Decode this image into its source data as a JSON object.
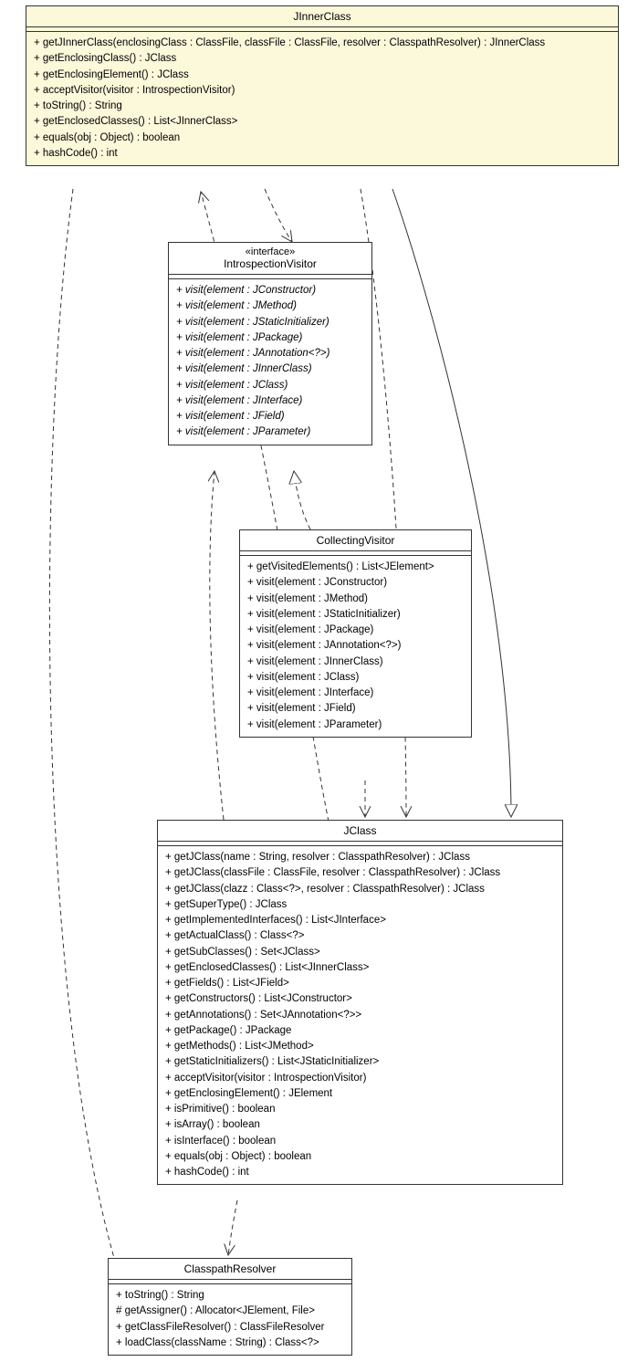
{
  "classes": {
    "jinnerclass": {
      "title": "JInnerClass",
      "ops": [
        "+ getJInnerClass(enclosingClass : ClassFile, classFile : ClassFile, resolver : ClasspathResolver) : JInnerClass",
        "+ getEnclosingClass() : JClass",
        "+ getEnclosingElement() : JClass",
        "+ acceptVisitor(visitor : IntrospectionVisitor)",
        "+ toString() : String",
        "+ getEnclosedClasses() : List<JInnerClass>",
        "+ equals(obj : Object) : boolean",
        "+ hashCode() : int"
      ]
    },
    "introspectionvisitor": {
      "stereotype": "«interface»",
      "title": "IntrospectionVisitor",
      "ops": [
        "+ visit(element : JConstructor)",
        "+ visit(element : JMethod)",
        "+ visit(element : JStaticInitializer)",
        "+ visit(element : JPackage)",
        "+ visit(element : JAnnotation<?>)",
        "+ visit(element : JInnerClass)",
        "+ visit(element : JClass)",
        "+ visit(element : JInterface)",
        "+ visit(element : JField)",
        "+ visit(element : JParameter)"
      ]
    },
    "collectingvisitor": {
      "title": "CollectingVisitor",
      "ops": [
        "+ getVisitedElements() : List<JElement>",
        "+ visit(element : JConstructor)",
        "+ visit(element : JMethod)",
        "+ visit(element : JStaticInitializer)",
        "+ visit(element : JPackage)",
        "+ visit(element : JAnnotation<?>)",
        "+ visit(element : JInnerClass)",
        "+ visit(element : JClass)",
        "+ visit(element : JInterface)",
        "+ visit(element : JField)",
        "+ visit(element : JParameter)"
      ]
    },
    "jclass": {
      "title": "JClass",
      "ops": [
        "+ getJClass(name : String, resolver : ClasspathResolver) : JClass",
        "+ getJClass(classFile : ClassFile, resolver : ClasspathResolver) : JClass",
        "+ getJClass(clazz : Class<?>, resolver : ClasspathResolver) : JClass",
        "+ getSuperType() : JClass",
        "+ getImplementedInterfaces() : List<JInterface>",
        "+ getActualClass() : Class<?>",
        "+ getSubClasses() : Set<JClass>",
        "+ getEnclosedClasses() : List<JInnerClass>",
        "+ getFields() : List<JField>",
        "+ getConstructors() : List<JConstructor>",
        "+ getAnnotations() : Set<JAnnotation<?>>",
        "+ getPackage() : JPackage",
        "+ getMethods() : List<JMethod>",
        "+ getStaticInitializers() : List<JStaticInitializer>",
        "+ acceptVisitor(visitor : IntrospectionVisitor)",
        "+ getEnclosingElement() : JElement",
        "+ isPrimitive() : boolean",
        "+ isArray() : boolean",
        "+ isInterface() : boolean",
        "+ equals(obj : Object) : boolean",
        "+ hashCode() : int"
      ]
    },
    "classpathresolver": {
      "title": "ClasspathResolver",
      "ops": [
        "+ toString() : String",
        "# getAssigner() : Allocator<JElement, File>",
        "+ getClassFileResolver() : ClassFileResolver",
        "+ loadClass(className : String) : Class<?>"
      ]
    }
  }
}
